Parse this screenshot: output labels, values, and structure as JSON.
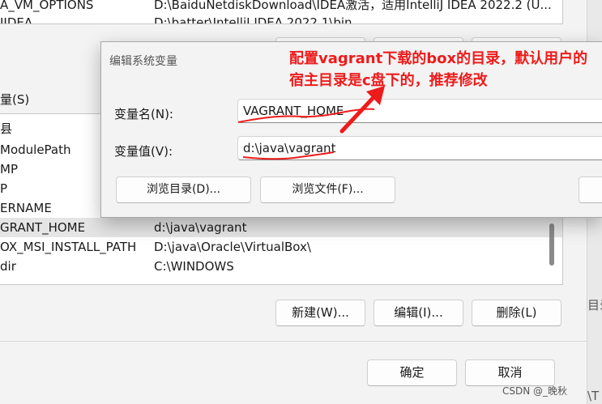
{
  "background": {
    "top_rows": [
      {
        "name": "A_VM_OPTIONS",
        "value": "D:\\BaiduNetdiskDownload\\IDEA激活，适用IntelliJ IDEA 2022.2 (U..."
      },
      {
        "name": "IIDEA",
        "value": "D:\\batter\\IntelliJ IDEA 2022.1\\bin"
      }
    ],
    "section_label": "量(S)",
    "rows": [
      {
        "name": "县",
        "value": ""
      },
      {
        "name": "ModulePath",
        "value": ""
      },
      {
        "name": "MP",
        "value": ""
      },
      {
        "name": "P",
        "value": ""
      },
      {
        "name": "ERNAME",
        "value": ""
      },
      {
        "name": "GRANT_HOME",
        "value": "d:\\java\\vagrant",
        "selected": true
      },
      {
        "name": "OX_MSI_INSTALL_PATH",
        "value": "D:\\java\\Oracle\\VirtualBox\\"
      },
      {
        "name": "dir",
        "value": "C:\\WINDOWS"
      }
    ],
    "buttons": {
      "new": "新建(W)...",
      "edit": "编辑(I)...",
      "delete": "删除(L)"
    },
    "ok": "确定",
    "cancel": "取消",
    "right_strip_text_1": "目录",
    "right_strip_text_2": "\\T"
  },
  "dialog": {
    "title": "编辑系统变量",
    "name_label": "变量名(N):",
    "name_value": "VAGRANT_HOME",
    "value_label": "变量值(V):",
    "value_value": "d:\\java\\vagrant",
    "browse_dir": "浏览目录(D)...",
    "browse_file": "浏览文件(F)..."
  },
  "annotation": {
    "line1": "配置vagrant下载的box的目录，默认用户的",
    "line2": "宿主目录是c盘下的，推荐修改",
    "color": "#ee1b1b"
  },
  "watermark": "CSDN @_晚秋"
}
